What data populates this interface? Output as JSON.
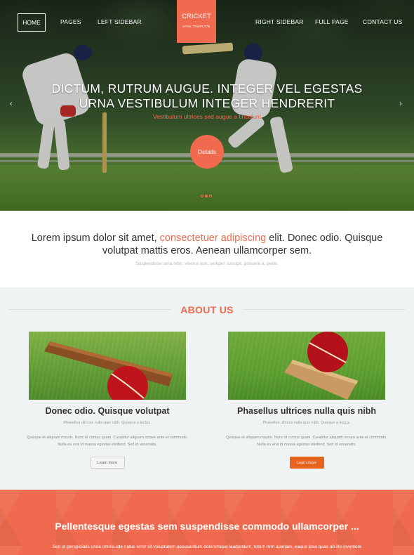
{
  "nav": {
    "home": "HOME",
    "pages": "PAGES",
    "left_sidebar": "LEFT SIDEBAR",
    "right_sidebar": "RIGHT SIDEBAR",
    "full_page": "FULL PAGE",
    "contact_us": "CONTACT US"
  },
  "logo": {
    "title": "CRICKET",
    "subtitle": "HTML TEMPLATE"
  },
  "hero": {
    "title_line1": "DICTUM, RUTRUM AUGUE. INTEGER VEL EGESTAS",
    "title_line2": "URNA VESTIBULUM INTEGER HENDRERIT",
    "subtitle": "Vestibulum ultrices sed augue a tincidunt",
    "button": "Details",
    "prev_icon": "chevron-left-icon",
    "next_icon": "chevron-right-icon",
    "slides": 3,
    "active_slide": 2
  },
  "intro": {
    "text_before": "Lorem ipsum dolor sit amet, ",
    "text_highlight": "consectetuer adipiscing",
    "text_after": " elit. Donec odio. Quisque volutpat mattis eros. Aenean ullamcorper sem.",
    "small": "Suspendisse urna nibh, viverra non, semper suscipit, posuere a, pede."
  },
  "about": {
    "title": "ABOUT US",
    "cards": [
      {
        "title": "Donec odio. Quisque volutpat",
        "subtitle": "Phasellus ultrices nulla quis nibh. Quisque a lectus.",
        "text_line1": "Quisque et aliquam mauris. Nunc id cursus quam. Curabitur aliquam ornare ante et commodo.",
        "text_line2": "Nulla eu erat id massa egestas eleifend. Sed id venenatis.",
        "button": "Learn more"
      },
      {
        "title": "Phasellus ultrices nulla quis nibh",
        "subtitle": "Phasellus ultrices nulla quis nibh. Quisque a lectus.",
        "text_line1": "Quisque et aliquam mauris. Nunc id cursus quam. Curabitur aliquam ornare ante et commodo.",
        "text_line2": "Nulla eu erat id massa egestas eleifend. Sed id venenatis.",
        "button": "Learn more"
      }
    ]
  },
  "banner": {
    "title": "Pellentesque egestas sem suspendisse commodo ullamcorper ...",
    "text": "Sed ut perspiciatis unde omnis iste natus error sit voluptatem accusantium doloremque laudantium, totam rem aperiam, eaque ipsa quae ab illo inventore"
  },
  "colors": {
    "accent": "#ef6a4e",
    "button_orange": "#e8631d",
    "about_bg": "#f0f3f4"
  }
}
